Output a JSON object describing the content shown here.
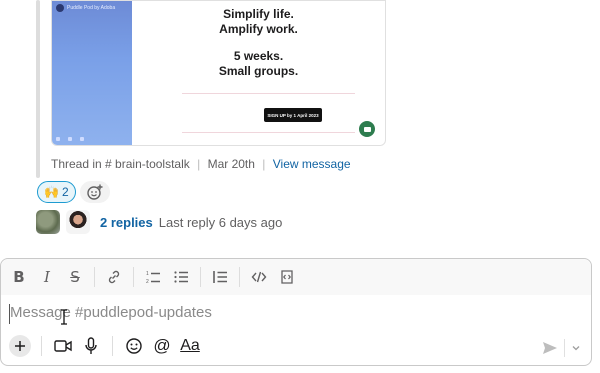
{
  "message": {
    "preview": {
      "brand": "Puddle Pod by Adoba",
      "hero_line1": "Simplify life.",
      "hero_line2": "Amplify work.",
      "hero_line3": "5 weeks.",
      "hero_line4": "Small groups.",
      "cta": "SIGN UP by 1 April 2023"
    },
    "thread": {
      "prefix": "Thread in",
      "channel": "# brain-toolstalk",
      "date": "Mar 20th",
      "link": "View message"
    },
    "reactions": [
      {
        "emoji": "🙌",
        "count": "2"
      }
    ],
    "replies": {
      "count_label": "2 replies",
      "last_label": "Last reply 6 days ago"
    }
  },
  "composer": {
    "placeholder": "Message #puddlepod-updates",
    "toolbar": [
      "bold",
      "italic",
      "strikethrough",
      "link",
      "ordered-list",
      "bulleted-list",
      "blockquote",
      "code",
      "code-block"
    ],
    "format_label": "Aa"
  },
  "colors": {
    "link": "#1264a3",
    "reaction_border": "#1d9bd1",
    "reaction_bg": "#e8f5fa",
    "muted": "#616061"
  }
}
